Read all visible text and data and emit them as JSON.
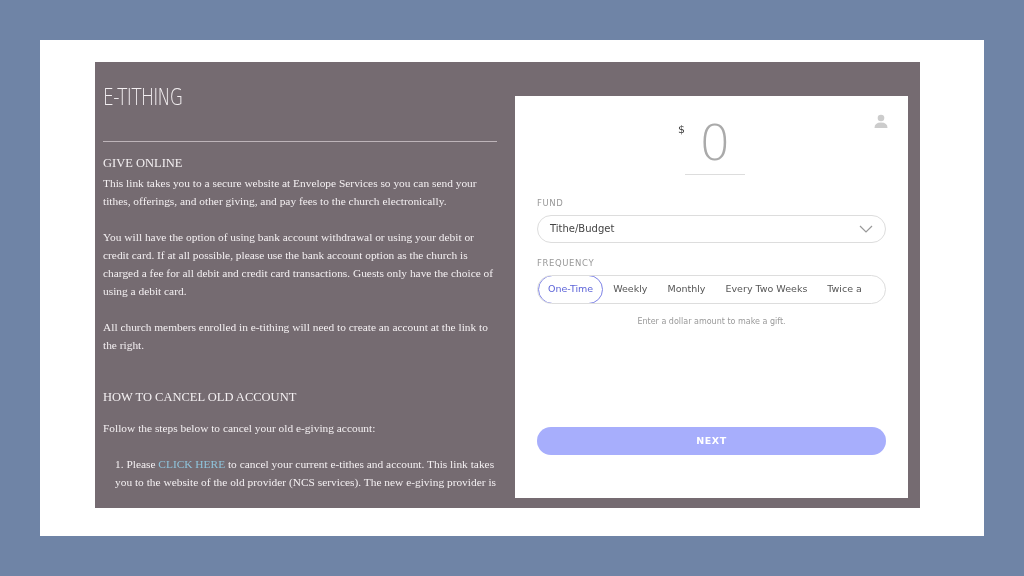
{
  "page_title": "E-TITHING",
  "give_online": {
    "heading": "GIVE ONLINE",
    "paragraphs": [
      "This link takes you to a secure website at Envelope Services so you can send your tithes, offerings, and other giving, and pay fees to the church electronically.",
      "You will have the option of using bank account withdrawal or using your debit or credit card. If at all possible, please use the bank account option as the church is charged a fee for all debit and credit card transactions. Guests only have the choice of using a debit card.",
      "All church members enrolled in e-tithing will need to create an account at the link to the right."
    ]
  },
  "cancel": {
    "heading": "HOW TO CANCEL OLD ACCOUNT",
    "intro": "Follow the steps below to cancel your old e-giving account:",
    "steps": [
      {
        "before": "1. Please ",
        "link": "CLICK HERE",
        "after": " to cancel your current e-tithes and account. This link takes you to the website of the old provider (NCS services). The new e-giving provider is"
      }
    ]
  },
  "giving_form": {
    "currency": "$",
    "amount": "0",
    "fund": {
      "label": "FUND",
      "value": "Tithe/Budget"
    },
    "frequency": {
      "label": "FREQUENCY",
      "options": [
        {
          "label": "One-Time",
          "selected": true
        },
        {
          "label": "Weekly",
          "selected": false
        },
        {
          "label": "Monthly",
          "selected": false
        },
        {
          "label": "Every Two Weeks",
          "selected": false
        },
        {
          "label": "Twice a",
          "selected": false
        }
      ]
    },
    "hint": "Enter a dollar amount to make a gift.",
    "next_button": "NEXT"
  }
}
